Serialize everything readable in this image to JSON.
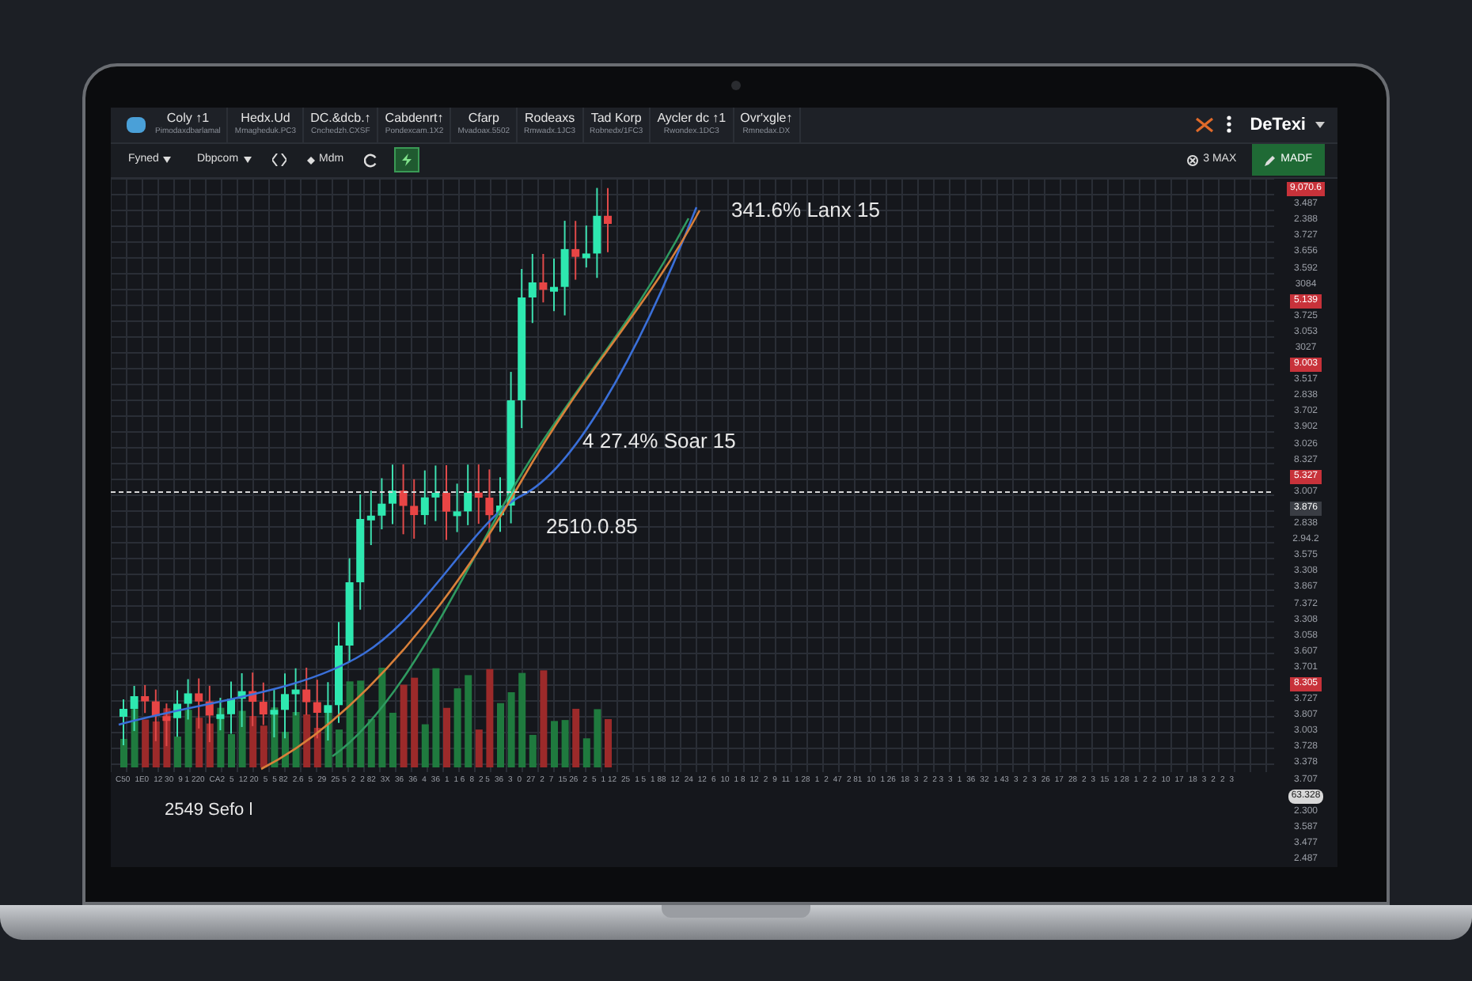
{
  "tabs": [
    {
      "title": "Coly ↑1",
      "subtitle": "Pimodaxdbarlamal"
    },
    {
      "title": "Hedx.Ud",
      "subtitle": "Mmagheduk.PC3"
    },
    {
      "title": "DC.&dcb.↑",
      "subtitle": "Cnchedzh.CXSF"
    },
    {
      "title": "Cabdenrt↑",
      "subtitle": "Pondexcam.1X2"
    },
    {
      "title": "Cfarp",
      "subtitle": "Mvadoax.5502"
    },
    {
      "title": "Rodeaxs",
      "subtitle": "Rmwadx.1JC3"
    },
    {
      "title": "Tad Korp",
      "subtitle": "Robnedx/1FC3"
    },
    {
      "title": "Aycler dc ↑1",
      "subtitle": "Rwondex.1DC3"
    },
    {
      "title": "Ovr'xgle↑",
      "subtitle": "Rmnedax.DX"
    }
  ],
  "brand": {
    "name": "DeTexi"
  },
  "toolbar": [
    {
      "kind": "dropdown",
      "label": "Fyned"
    },
    {
      "kind": "dropdown",
      "label": "Dbpcom"
    },
    {
      "kind": "icon"
    },
    {
      "kind": "tool",
      "label": "Mdm"
    },
    {
      "kind": "refresh"
    },
    {
      "kind": "toggle",
      "on": true
    }
  ],
  "toolbar_right": {
    "zoom": "3 MAX",
    "action": "MADF"
  },
  "annotations": [
    {
      "text": "341.6% Lanx 15"
    },
    {
      "text": "4 27.4% Soar 15"
    },
    {
      "text": "2510.0.85"
    }
  ],
  "footer_note": "2549 Sefo l",
  "price_axis": [
    {
      "label": "9,070.6",
      "kind": "alert"
    },
    {
      "label": "3.487",
      "kind": "plain"
    },
    {
      "label": "2.388",
      "kind": "plain"
    },
    {
      "label": "3.727",
      "kind": "plain"
    },
    {
      "label": "3.656",
      "kind": "plain"
    },
    {
      "label": "3.592",
      "kind": "plain"
    },
    {
      "label": "3084",
      "kind": "plain"
    },
    {
      "label": "5.139",
      "kind": "alert"
    },
    {
      "label": "3.725",
      "kind": "plain"
    },
    {
      "label": "3.053",
      "kind": "plain"
    },
    {
      "label": "3027",
      "kind": "plain"
    },
    {
      "label": "9.003",
      "kind": "alert"
    },
    {
      "label": "3.517",
      "kind": "plain"
    },
    {
      "label": "2.838",
      "kind": "plain"
    },
    {
      "label": "3.702",
      "kind": "plain"
    },
    {
      "label": "3.902",
      "kind": "plain"
    },
    {
      "label": "3.026",
      "kind": "plain"
    },
    {
      "label": "8.327",
      "kind": "plain"
    },
    {
      "label": "5.327",
      "kind": "alert"
    },
    {
      "label": "3.007",
      "kind": "plain"
    },
    {
      "label": "3.876",
      "kind": "current"
    },
    {
      "label": "2.838",
      "kind": "plain"
    },
    {
      "label": "2.94.2",
      "kind": "plain"
    },
    {
      "label": "3.575",
      "kind": "plain"
    },
    {
      "label": "3.308",
      "kind": "plain"
    },
    {
      "label": "3.867",
      "kind": "plain"
    },
    {
      "label": "7.372",
      "kind": "plain"
    },
    {
      "label": "3.308",
      "kind": "plain"
    },
    {
      "label": "3.058",
      "kind": "plain"
    },
    {
      "label": "3.607",
      "kind": "plain"
    },
    {
      "label": "3.701",
      "kind": "plain"
    },
    {
      "label": "8.305",
      "kind": "alert"
    },
    {
      "label": "3.727",
      "kind": "plain"
    },
    {
      "label": "3.807",
      "kind": "plain"
    },
    {
      "label": "3.003",
      "kind": "plain"
    },
    {
      "label": "3.728",
      "kind": "plain"
    },
    {
      "label": "3.378",
      "kind": "plain"
    },
    {
      "label": "3.707",
      "kind": "plain"
    },
    {
      "label": "63.328",
      "kind": "badge"
    },
    {
      "label": "2.300",
      "kind": "plain"
    },
    {
      "label": "3.587",
      "kind": "plain"
    },
    {
      "label": "3.477",
      "kind": "plain"
    },
    {
      "label": "2.487",
      "kind": "plain"
    }
  ],
  "time_axis": [
    "C50",
    "1E0",
    "12 30",
    "9 1 220",
    "CA2",
    "5",
    "12 20",
    "5",
    "5 82",
    "2.6",
    "5",
    "29",
    "25 5",
    "2",
    "2 82",
    "3X",
    "36",
    "36",
    "4",
    "36",
    "1",
    "1 6",
    "8",
    "2 5",
    "36",
    "3",
    "0",
    "27",
    "2",
    "7",
    "15 26",
    "2",
    "5",
    "1 12",
    "25",
    "1 5",
    "1 88",
    "12",
    "24",
    "12",
    "6",
    "10",
    "1 8",
    "12",
    "2",
    "9",
    "11",
    "1 28",
    "1",
    "2",
    "47",
    "2 81",
    "10",
    "1 26",
    "18",
    "3",
    "2",
    "2 3",
    "3",
    "1",
    "36",
    "32",
    "1 43",
    "3",
    "2",
    "3",
    "26",
    "17",
    "28",
    "2",
    "3",
    "15",
    "1 28",
    "1",
    "2",
    "2",
    "10",
    "17",
    "18",
    "3",
    "2",
    "2",
    "3"
  ]
}
